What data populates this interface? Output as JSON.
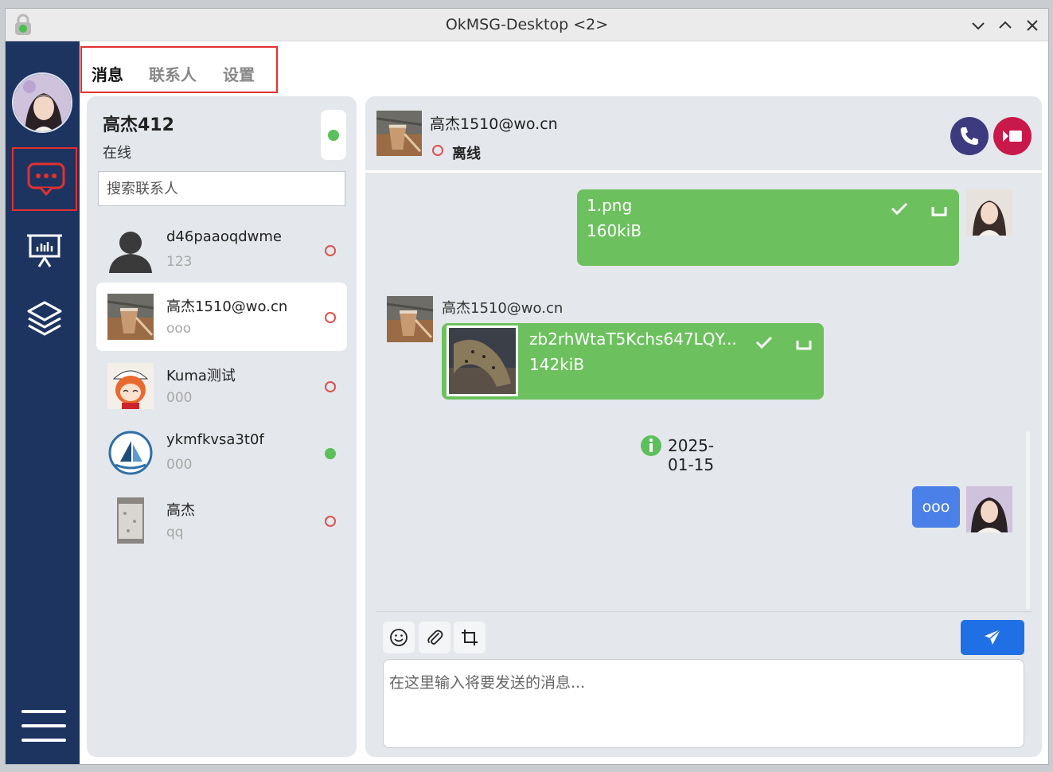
{
  "window": {
    "title": "OkMSG-Desktop <2>"
  },
  "sidebar": {
    "items": [
      {
        "name": "messages",
        "icon": "chat-bubble-icon"
      },
      {
        "name": "presentation",
        "icon": "presentation-chart-icon"
      },
      {
        "name": "layers",
        "icon": "layers-icon"
      }
    ],
    "menu_icon": "hamburger-menu-icon"
  },
  "tabs": [
    {
      "label": "消息",
      "active": true
    },
    {
      "label": "联系人",
      "active": false
    },
    {
      "label": "设置",
      "active": false
    }
  ],
  "profile": {
    "name": "高杰412",
    "status": "在线",
    "online": true
  },
  "search": {
    "placeholder": "搜索联系人"
  },
  "contacts": [
    {
      "name": "d46paaoqdwme",
      "last_message": "123",
      "online": false
    },
    {
      "name": "高杰1510@wo.cn",
      "last_message": "ooo",
      "online": false,
      "selected": true
    },
    {
      "name": "Kuma测试",
      "last_message": "000",
      "online": false
    },
    {
      "name": "ykmfkvsa3t0f",
      "last_message": "000",
      "online": true
    },
    {
      "name": "高杰",
      "last_message": "qq",
      "online": false
    }
  ],
  "chat": {
    "contact_name": "高杰1510@wo.cn",
    "contact_status": "离线",
    "messages": [
      {
        "type": "file",
        "direction": "out",
        "filename": "1.png",
        "size": "160kiB"
      },
      {
        "type": "file",
        "direction": "in",
        "sender": "高杰1510@wo.cn",
        "filename": "zb2rhWtaT5Kchs647LQY...",
        "size": "142kiB"
      },
      {
        "type": "date",
        "text": "2025-01-15"
      },
      {
        "type": "text",
        "direction": "out",
        "text": "ooo"
      }
    ],
    "input_placeholder": "在这里输入将要发送的消息..."
  },
  "colors": {
    "sidebar": "#1d3461",
    "outgoing_bubble": "#6cc15e",
    "text_bubble": "#4b80e8",
    "send_button": "#1f6fe5",
    "call_button": "#3d3a80",
    "video_button": "#c8194a",
    "online": "#5cbf5c",
    "offline": "#d9534f"
  }
}
